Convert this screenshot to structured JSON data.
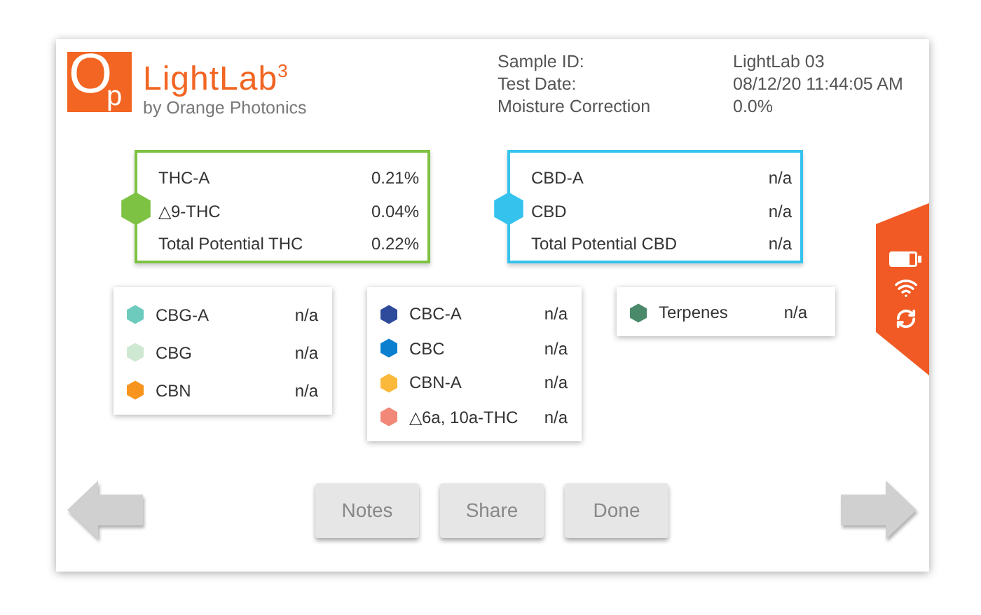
{
  "logo": {
    "mark": [
      "O",
      "p"
    ],
    "title": "LightLab$^{3}$",
    "tagline": "by Orange Photonics"
  },
  "sample_info": [
    {
      "label": "Sample ID:",
      "value": "LightLab 03"
    },
    {
      "label": "Test Date:",
      "value": "08/12/20 11:44:05 AM"
    },
    {
      "label": "Moisture Correction",
      "value": "0.0%"
    }
  ],
  "main_groups": [
    {
      "color": "#7dc242",
      "rows": [
        {
          "name": "THC-A",
          "value": "0.21%"
        },
        {
          "name": "△9-THC",
          "value": "0.04%"
        },
        {
          "name": "Total Potential THC",
          "value": "0.22%"
        }
      ]
    },
    {
      "color": "#35c3ee",
      "rows": [
        {
          "name": "CBD-A",
          "value": "n/a"
        },
        {
          "name": "CBD",
          "value": "n/a"
        },
        {
          "name": "Total Potential CBD",
          "value": "n/a"
        }
      ]
    }
  ],
  "other_groups": [
    {
      "rows": [
        {
          "name": "CBG-A",
          "value": "n/a",
          "color": "#6ccbbd"
        },
        {
          "name": "CBG",
          "value": "n/a",
          "color": "#cfe8d2"
        },
        {
          "name": "CBN",
          "value": "n/a",
          "color": "#f7941d"
        }
      ]
    },
    {
      "rows": [
        {
          "name": "CBC-A",
          "value": "n/a",
          "color": "#2e4b9b"
        },
        {
          "name": "CBC",
          "value": "n/a",
          "color": "#0a7fcf"
        },
        {
          "name": "CBN-A",
          "value": "n/a",
          "color": "#fbb93c"
        },
        {
          "name": "△6a, 10a-THC",
          "value": "n/a",
          "color": "#f28877"
        }
      ]
    },
    {
      "rows": [
        {
          "name": "Terpenes",
          "value": "n/a",
          "color": "#4a8a6a"
        }
      ]
    }
  ],
  "buttons": [
    "Notes",
    "Share",
    "Done"
  ]
}
